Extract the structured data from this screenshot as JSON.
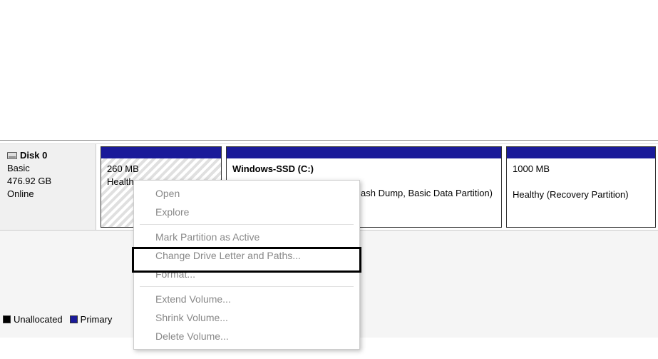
{
  "disk": {
    "name": "Disk 0",
    "type": "Basic",
    "size": "476.92 GB",
    "status": "Online"
  },
  "partitions": [
    {
      "title": "",
      "size": "260 MB",
      "status": "Healthy"
    },
    {
      "title": "Windows-SSD  (C:)",
      "subtitle": "",
      "status_partial": "ash Dump, Basic Data Partition)"
    },
    {
      "title": "",
      "size": "1000 MB",
      "status": "Healthy (Recovery Partition)"
    }
  ],
  "legend": {
    "unallocated": "Unallocated",
    "primary": "Primary"
  },
  "context_menu": {
    "open": "Open",
    "explore": "Explore",
    "mark_active": "Mark Partition as Active",
    "change_drive": "Change Drive Letter and Paths...",
    "format": "Format...",
    "extend": "Extend Volume...",
    "shrink": "Shrink Volume...",
    "delete": "Delete Volume..."
  }
}
